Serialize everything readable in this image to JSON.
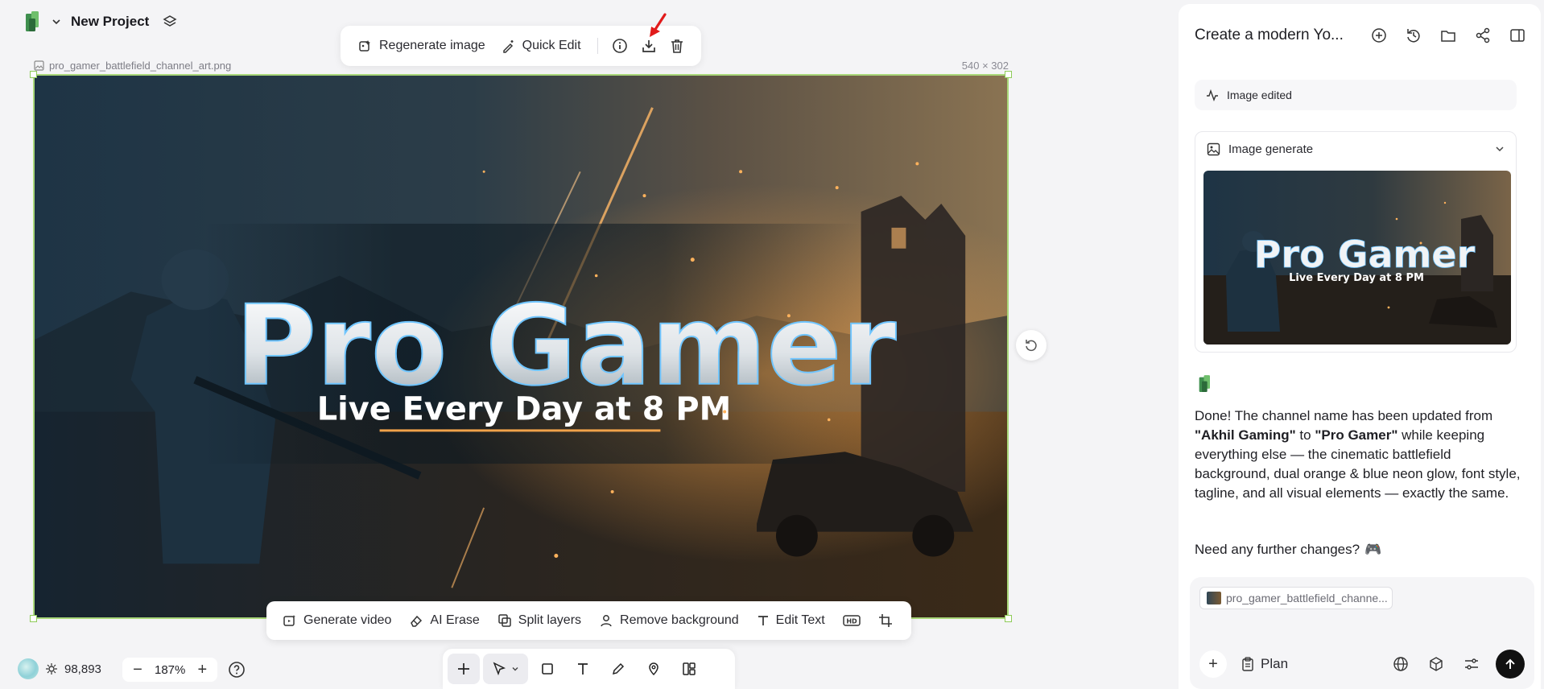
{
  "project": {
    "name": "New Project"
  },
  "image_toolbar": {
    "regenerate_label": "Regenerate image",
    "quick_edit_label": "Quick Edit"
  },
  "canvas": {
    "file_name": "pro_gamer_battlefield_channel_art.png",
    "dimensions": "540 × 302",
    "image_title": "Pro Gamer",
    "image_tagline": "Live Every Day at 8 PM"
  },
  "action_bar": {
    "generate_video": "Generate video",
    "ai_erase": "AI Erase",
    "split_layers": "Split layers",
    "remove_background": "Remove background",
    "edit_text": "Edit Text"
  },
  "footer": {
    "credits": "98,893",
    "zoom": "187%"
  },
  "panel": {
    "title": "Create a modern Yo...",
    "status_label": "Image edited",
    "generate_card_label": "Image generate",
    "thumb_title": "Pro Gamer",
    "thumb_tagline": "Live Every Day at 8 PM",
    "message": {
      "p1": "Done! The channel name has been updated from ",
      "old_name": "\"Akhil Gaming\"",
      "p2": " to ",
      "new_name": "\"Pro Gamer\"",
      "p3": " while keeping everything else — the cinematic battlefield background, dual orange & blue neon glow, font style, tagline, and all visual elements — exactly the same."
    },
    "followup": "Need any further changes?",
    "followup_emoji": "🎮",
    "composer": {
      "attachment": "pro_gamer_battlefield_channe...",
      "plan_label": "Plan"
    }
  },
  "colors": {
    "accent_green": "#a9d779",
    "annotation_arrow": "#e11a1a",
    "send_button": "#111111"
  }
}
